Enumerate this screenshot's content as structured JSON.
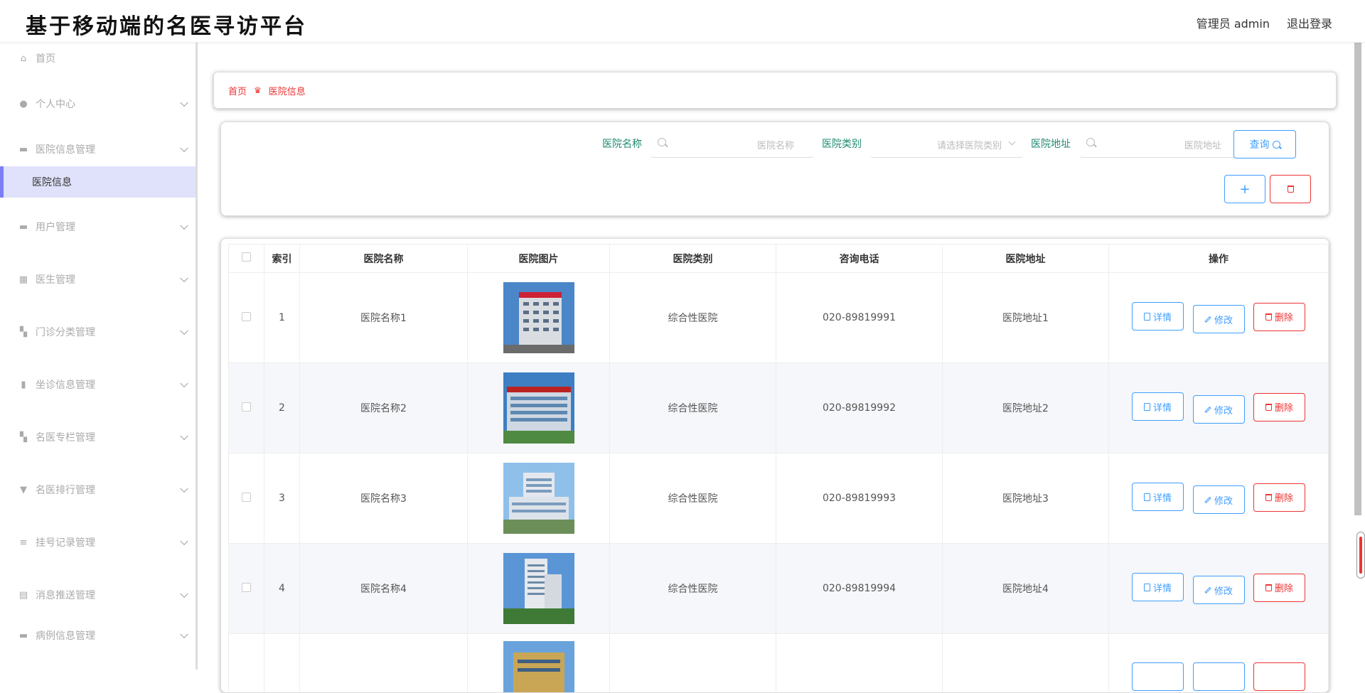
{
  "header": {
    "title": "基于移动端的名医寻访平台",
    "user": "管理员 admin",
    "logout": "退出登录"
  },
  "sidebar": {
    "home": "首页",
    "items": [
      {
        "label": "个人中心",
        "icon": "person-icon"
      },
      {
        "label": "医院信息管理",
        "icon": "chart-icon"
      },
      {
        "label": "用户管理",
        "icon": "monitor-icon"
      },
      {
        "label": "医生管理",
        "icon": "grid-icon"
      },
      {
        "label": "门诊分类管理",
        "icon": "apps-icon"
      },
      {
        "label": "坐诊信息管理",
        "icon": "bar-chart-icon"
      },
      {
        "label": "名医专栏管理",
        "icon": "apps-icon"
      },
      {
        "label": "名医排行管理",
        "icon": "trophy-icon"
      },
      {
        "label": "挂号记录管理",
        "icon": "list-icon"
      },
      {
        "label": "消息推送管理",
        "icon": "clipboard-icon"
      },
      {
        "label": "病例信息管理",
        "icon": "folder-icon"
      }
    ],
    "active_sub": "医院信息"
  },
  "breadcrumb": {
    "home": "首页",
    "current": "医院信息"
  },
  "search": {
    "name_label": "医院名称",
    "name_placeholder": "医院名称",
    "type_label": "医院类别",
    "type_placeholder": "请选择医院类别",
    "addr_label": "医院地址",
    "addr_placeholder": "医院地址",
    "query_label": "查询"
  },
  "table": {
    "columns": [
      "索引",
      "医院名称",
      "医院图片",
      "医院类别",
      "咨询电话",
      "医院地址",
      "操作"
    ],
    "actions": {
      "detail": "详情",
      "edit": "修改",
      "delete": "删除"
    },
    "rows": [
      {
        "index": "1",
        "name": "医院名称1",
        "type": "综合性医院",
        "phone": "020-89819991",
        "address": "医院地址1"
      },
      {
        "index": "2",
        "name": "医院名称2",
        "type": "综合性医院",
        "phone": "020-89819992",
        "address": "医院地址2"
      },
      {
        "index": "3",
        "name": "医院名称3",
        "type": "综合性医院",
        "phone": "020-89819993",
        "address": "医院地址3"
      },
      {
        "index": "4",
        "name": "医院名称4",
        "type": "综合性医院",
        "phone": "020-89819994",
        "address": "医院地址4"
      },
      {
        "index": "",
        "name": "",
        "type": "",
        "phone": "",
        "address": ""
      }
    ]
  },
  "colors": {
    "accent": "#409eff",
    "danger": "#e33333",
    "label": "#1f8a70",
    "active_bg": "#e0e2fb"
  }
}
